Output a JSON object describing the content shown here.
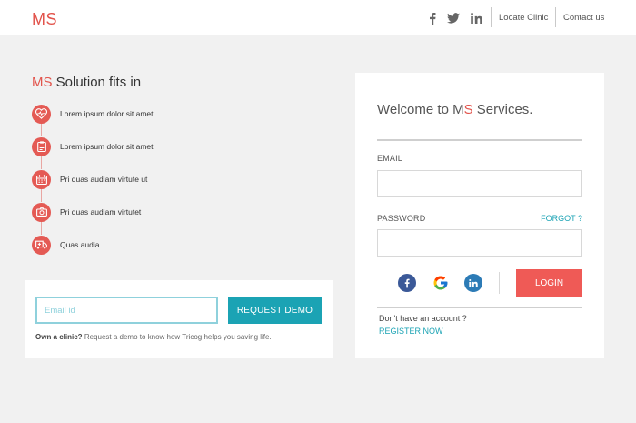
{
  "brand": {
    "logo": "MS",
    "accent_color": "#e2534b",
    "teal_color": "#1ba3b4"
  },
  "topnav": {
    "social": [
      {
        "name": "facebook-icon",
        "glyph": "f"
      },
      {
        "name": "twitter-icon",
        "glyph": "t"
      },
      {
        "name": "linkedin-icon",
        "glyph": "in"
      }
    ],
    "locate_label": "Locate Clinic",
    "contact_label": "Contact us"
  },
  "intro": {
    "brand": "MS",
    "heading": "Solution fits in",
    "features": [
      {
        "icon": "heart-rate-icon",
        "text": "Lorem ipsum dolor sit amet"
      },
      {
        "icon": "clipboard-icon",
        "text": "Lorem ipsum dolor sit amet"
      },
      {
        "icon": "calendar-icon",
        "text": "Pri quas audiam virtute ut"
      },
      {
        "icon": "camera-icon",
        "text": "Pri quas audiam virtutet"
      },
      {
        "icon": "ambulance-icon",
        "text": "Quas audia"
      }
    ]
  },
  "demo": {
    "email_placeholder": "Email id",
    "button_label": "REQUEST DEMO",
    "note_bold": "Own a clinic?",
    "note_text": "Request a demo to know how Tricog helps you saving life."
  },
  "login": {
    "welcome_prefix": "Welcome to",
    "welcome_m": "M",
    "welcome_s": "S",
    "welcome_suffix": "Services.",
    "email_label": "EMAIL",
    "password_label": "PASSWORD",
    "forgot_label": "FORGOT ?",
    "login_label": "LOGIN",
    "no_account": "Don't have an account ?",
    "register_label": "REGISTER NOW",
    "social_icons": [
      "facebook-icon",
      "google-icon",
      "linkedin-icon"
    ]
  }
}
